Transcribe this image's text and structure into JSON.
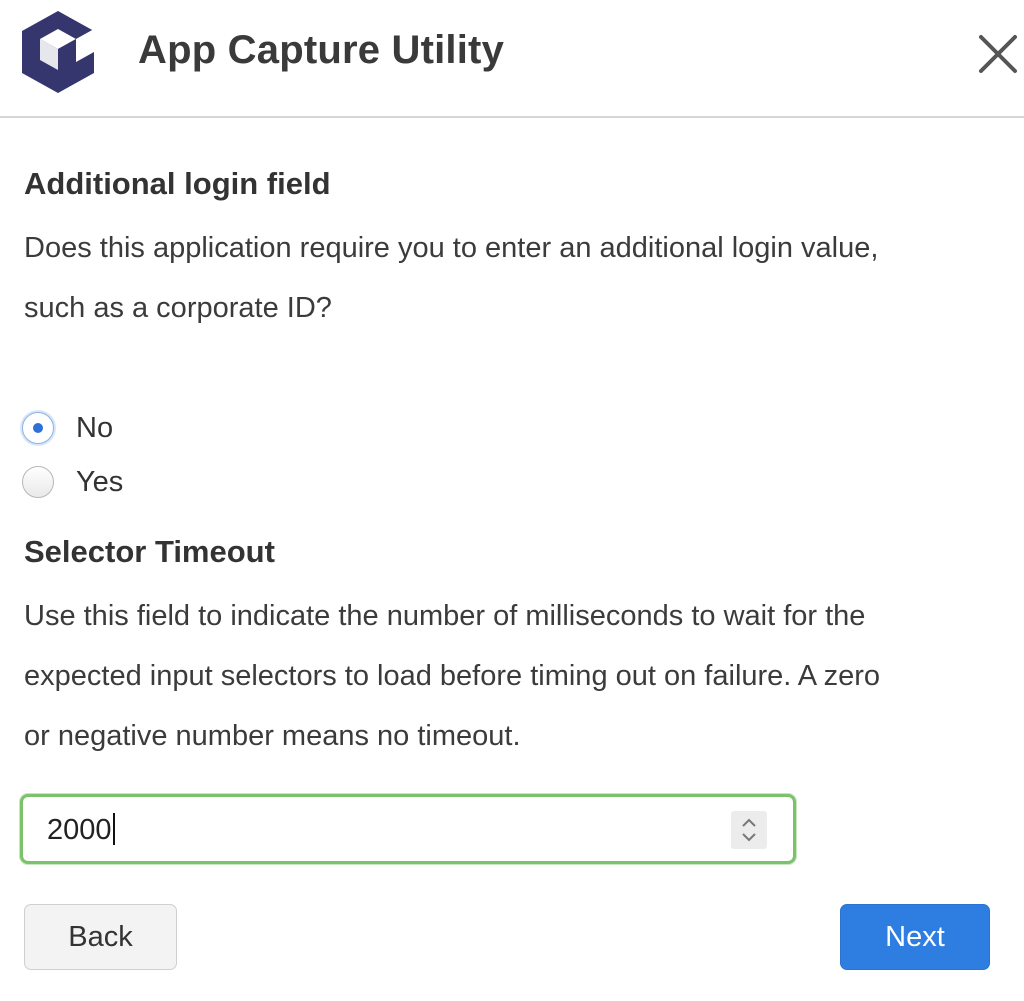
{
  "header": {
    "app_title": "App Capture Utility",
    "logo_icon": "cube-logo-icon",
    "close_icon": "close-icon"
  },
  "login_section": {
    "title": "Additional login field",
    "description_line1": "Does this application require you to enter an additional login value,",
    "description_line2": "such as a corporate ID?",
    "options": [
      {
        "label": "No",
        "checked": true
      },
      {
        "label": "Yes",
        "checked": false
      }
    ]
  },
  "timeout_section": {
    "title": "Selector Timeout",
    "description_line1": "Use this field to indicate the number of milliseconds to wait for the",
    "description_line2": "expected input selectors to load before timing out on failure. A zero",
    "description_line3": "or negative number means no timeout.",
    "value": "2000",
    "spinner_icon": "spinner-arrows-icon"
  },
  "footer": {
    "back_label": "Back",
    "next_label": "Next"
  },
  "colors": {
    "logo": "#35366e",
    "accent": "#2e7de0",
    "focus_border": "#7cc26a"
  }
}
